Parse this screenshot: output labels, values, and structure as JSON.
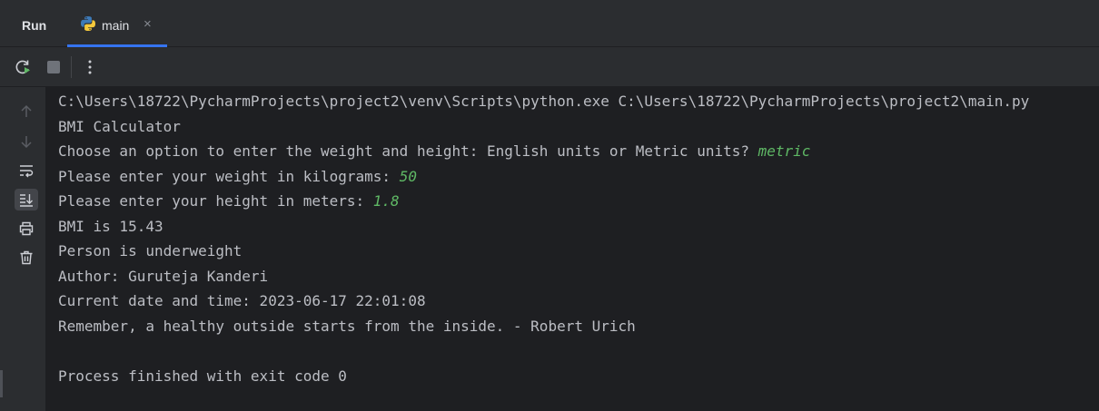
{
  "tabbar": {
    "title": "Run",
    "tab": {
      "label": "main",
      "icon": "python-icon",
      "close": "×"
    }
  },
  "toolbar": {
    "buttons": [
      "rerun-icon",
      "stop-icon",
      "more-vertical-icon"
    ]
  },
  "gutter": {
    "buttons": [
      "arrow-up-icon",
      "arrow-down-icon",
      "soft-wrap-icon",
      "scroll-to-end-icon",
      "print-icon",
      "trash-icon"
    ]
  },
  "console": {
    "cmd": "C:\\Users\\18722\\PycharmProjects\\project2\\venv\\Scripts\\python.exe C:\\Users\\18722\\PycharmProjects\\project2\\main.py",
    "l1": "BMI Calculator",
    "l2": "Choose an option to enter the weight and height: English units or Metric units? ",
    "l2_input": "metric",
    "l3": "Please enter your weight in kilograms: ",
    "l3_input": "50",
    "l4": "Please enter your height in meters: ",
    "l4_input": "1.8",
    "l5": "BMI is 15.43",
    "l6": "Person is underweight",
    "l7": "Author: Guruteja Kanderi",
    "l8": "Current date and time: 2023-06-17 22:01:08",
    "l9": "Remember, a healthy outside starts from the inside. - Robert Urich",
    "exit": "Process finished with exit code 0"
  },
  "colors": {
    "background": "#1e1f22",
    "panel": "#2b2d30",
    "text": "#bcbec4",
    "user_input": "#5fb865",
    "accent": "#3574f0"
  }
}
